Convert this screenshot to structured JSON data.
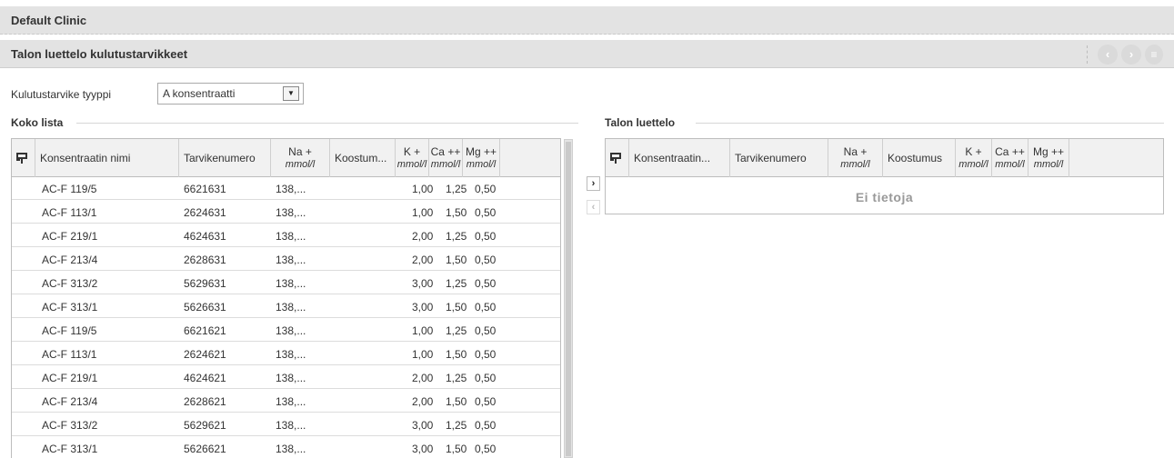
{
  "header": {
    "clinic": "Default Clinic"
  },
  "titlebar": {
    "title": "Talon luettelo kulutustarvikkeet",
    "nav_prev": "‹",
    "nav_next": "›",
    "nav_menu": "≡"
  },
  "filter": {
    "label": "Kulutustarvike tyyppi",
    "value": "A konsentraatti"
  },
  "left": {
    "title": "Koko lista",
    "headers": {
      "name": "Konsentraatin nimi",
      "code": "Tarvikenumero",
      "na": "Na +",
      "na_unit": "mmol/l",
      "comp": "Koostum...",
      "k": "K +",
      "k_unit": "mmol/l",
      "ca": "Ca ++",
      "ca_unit": "mmol/l",
      "mg": "Mg ++",
      "mg_unit": "mmol/l"
    },
    "rows": [
      [
        "AC-F 119/5",
        "6621631",
        "138,...",
        "",
        "1,00",
        "1,25",
        "0,50"
      ],
      [
        "AC-F 113/1",
        "2624631",
        "138,...",
        "",
        "1,00",
        "1,50",
        "0,50"
      ],
      [
        "AC-F 219/1",
        "4624631",
        "138,...",
        "",
        "2,00",
        "1,25",
        "0,50"
      ],
      [
        "AC-F 213/4",
        "2628631",
        "138,...",
        "",
        "2,00",
        "1,50",
        "0,50"
      ],
      [
        "AC-F 313/2",
        "5629631",
        "138,...",
        "",
        "3,00",
        "1,25",
        "0,50"
      ],
      [
        "AC-F 313/1",
        "5626631",
        "138,...",
        "",
        "3,00",
        "1,50",
        "0,50"
      ],
      [
        "AC-F 119/5",
        "6621621",
        "138,...",
        "",
        "1,00",
        "1,25",
        "0,50"
      ],
      [
        "AC-F 113/1",
        "2624621",
        "138,...",
        "",
        "1,00",
        "1,50",
        "0,50"
      ],
      [
        "AC-F 219/1",
        "4624621",
        "138,...",
        "",
        "2,00",
        "1,25",
        "0,50"
      ],
      [
        "AC-F 213/4",
        "2628621",
        "138,...",
        "",
        "2,00",
        "1,50",
        "0,50"
      ],
      [
        "AC-F 313/2",
        "5629621",
        "138,...",
        "",
        "3,00",
        "1,25",
        "0,50"
      ],
      [
        "AC-F 313/1",
        "5626621",
        "138,...",
        "",
        "3,00",
        "1,50",
        "0,50"
      ]
    ]
  },
  "move": {
    "add": "›",
    "remove": "‹"
  },
  "right": {
    "title": "Talon luettelo",
    "headers": {
      "name": "Konsentraatin...",
      "code": "Tarvikenumero",
      "na": "Na +",
      "na_unit": "mmol/l",
      "comp": "Koostumus",
      "k": "K +",
      "k_unit": "mmol/l",
      "ca": "Ca ++",
      "ca_unit": "mmol/l",
      "mg": "Mg ++",
      "mg_unit": "mmol/l"
    },
    "empty": "Ei tietoja"
  }
}
